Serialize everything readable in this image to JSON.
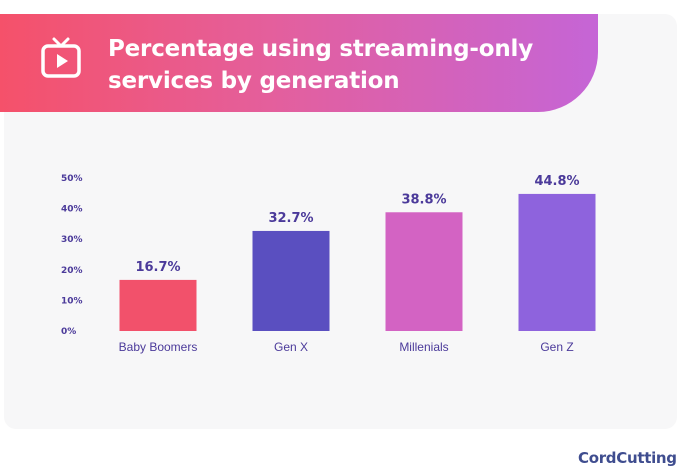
{
  "header": {
    "title_line1": "Percentage using streaming-only",
    "title_line2": "services by generation",
    "icon": "tv-icon"
  },
  "brand": "CordCutting",
  "colors": {
    "banner_start": "#f5516a",
    "banner_end": "#c565d6",
    "text": "#4b3a9a"
  },
  "chart_data": {
    "type": "bar",
    "title": "Percentage using streaming-only services by generation",
    "categories": [
      "Baby Boomers",
      "Gen X",
      "Millenials",
      "Gen Z"
    ],
    "values": [
      16.7,
      32.7,
      38.8,
      44.8
    ],
    "value_labels": [
      "16.7%",
      "32.7%",
      "38.8%",
      "44.8%"
    ],
    "bar_colors": [
      "#f2516b",
      "#5a4fc0",
      "#d363c3",
      "#8e63dd"
    ],
    "y_ticks": [
      0,
      10,
      20,
      30,
      40,
      50
    ],
    "y_tick_labels": [
      "0%",
      "10%",
      "20%",
      "30%",
      "40%",
      "50%"
    ],
    "ylim": [
      0,
      50
    ],
    "xlabel": "",
    "ylabel": "",
    "grid": false,
    "legend": "none"
  }
}
